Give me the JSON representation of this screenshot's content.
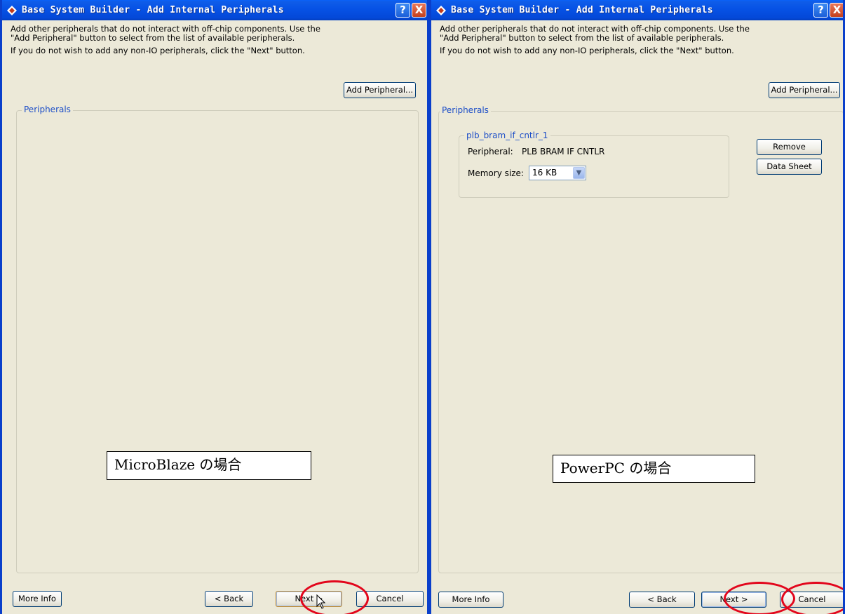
{
  "left_window": {
    "title": "Base System Builder - Add Internal Peripherals",
    "help_button": "?",
    "close_button": "X",
    "description_line1": "Add other peripherals that do not interact with off-chip components.  Use the",
    "description_line2": "\"Add Peripheral\" button to select from the list of available peripherals.",
    "description_line3": "If you do not wish to add any non-IO peripherals, click the \"Next\" button.",
    "add_peripheral_label": "Add Peripheral...",
    "peripherals_group_label": "Peripherals",
    "annotation": "MicroBlaze の場合",
    "footer": {
      "more_info": "More Info",
      "back": "< Back",
      "next": "Next >",
      "cancel": "Cancel"
    }
  },
  "right_window": {
    "title": "Base System Builder - Add Internal Peripherals",
    "help_button": "?",
    "close_button": "X",
    "description_line1": "Add other peripherals that do not interact with off-chip components.  Use the",
    "description_line2": "\"Add Peripheral\" button to select from the list of available peripherals.",
    "description_line3": "If you do not wish to add any non-IO peripherals, click the \"Next\" button.",
    "add_peripheral_label": "Add Peripheral...",
    "peripherals_group_label": "Peripherals",
    "peripheral_instance": {
      "name": "plb_bram_if_cntlr_1",
      "peripheral_label": "Peripheral:",
      "peripheral_value": "PLB BRAM IF CNTLR",
      "memory_size_label": "Memory size:",
      "memory_size_value": "16 KB",
      "remove_label": "Remove",
      "data_sheet_label": "Data Sheet"
    },
    "annotation": "PowerPC の場合",
    "footer": {
      "more_info": "More Info",
      "back": "< Back",
      "next": "Next >",
      "cancel": "Cancel"
    }
  },
  "colors": {
    "titlebar": "#0753e6",
    "dialog_bg": "#ECE9D8",
    "group_label": "#1d4ec7",
    "highlight_ellipse": "#e2061c"
  },
  "icons": [
    "app-icon",
    "help-icon",
    "close-icon",
    "dropdown-arrow-icon",
    "mouse-cursor-icon"
  ]
}
